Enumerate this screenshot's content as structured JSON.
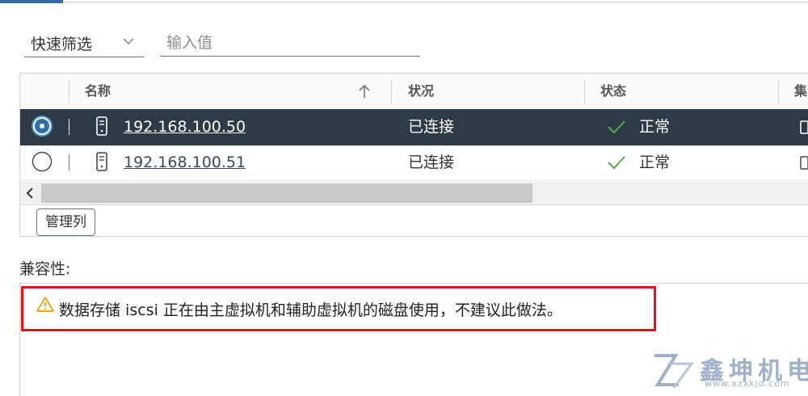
{
  "filter": {
    "quick_filter_label": "快速筛选",
    "input_placeholder": "输入值"
  },
  "grid": {
    "columns": [
      {
        "label": "名称",
        "sorted": "ascending"
      },
      {
        "label": "状况"
      },
      {
        "label": "状态"
      },
      {
        "label": "集"
      }
    ],
    "rows": [
      {
        "selected": true,
        "name": "192.168.100.50",
        "condition": "已连接",
        "status": "正常"
      },
      {
        "selected": false,
        "name": "192.168.100.51",
        "condition": "已连接",
        "status": "正常"
      }
    ],
    "manage_columns_label": "管理列"
  },
  "compatibility": {
    "title": "兼容性:",
    "message": "数据存储 iscsi 正在由主虚拟机和辅助虚拟机的磁盘使用，不建议此做法。"
  },
  "watermark": {
    "name": "鑫坤机电",
    "url": "www.xzxkjd.com"
  },
  "colors": {
    "selected_row": "#2d3b46",
    "alert_border": "#e0141e",
    "accent": "#2f6da8",
    "ok_check": "#3c8c3c",
    "warning": "#e5a00d"
  }
}
